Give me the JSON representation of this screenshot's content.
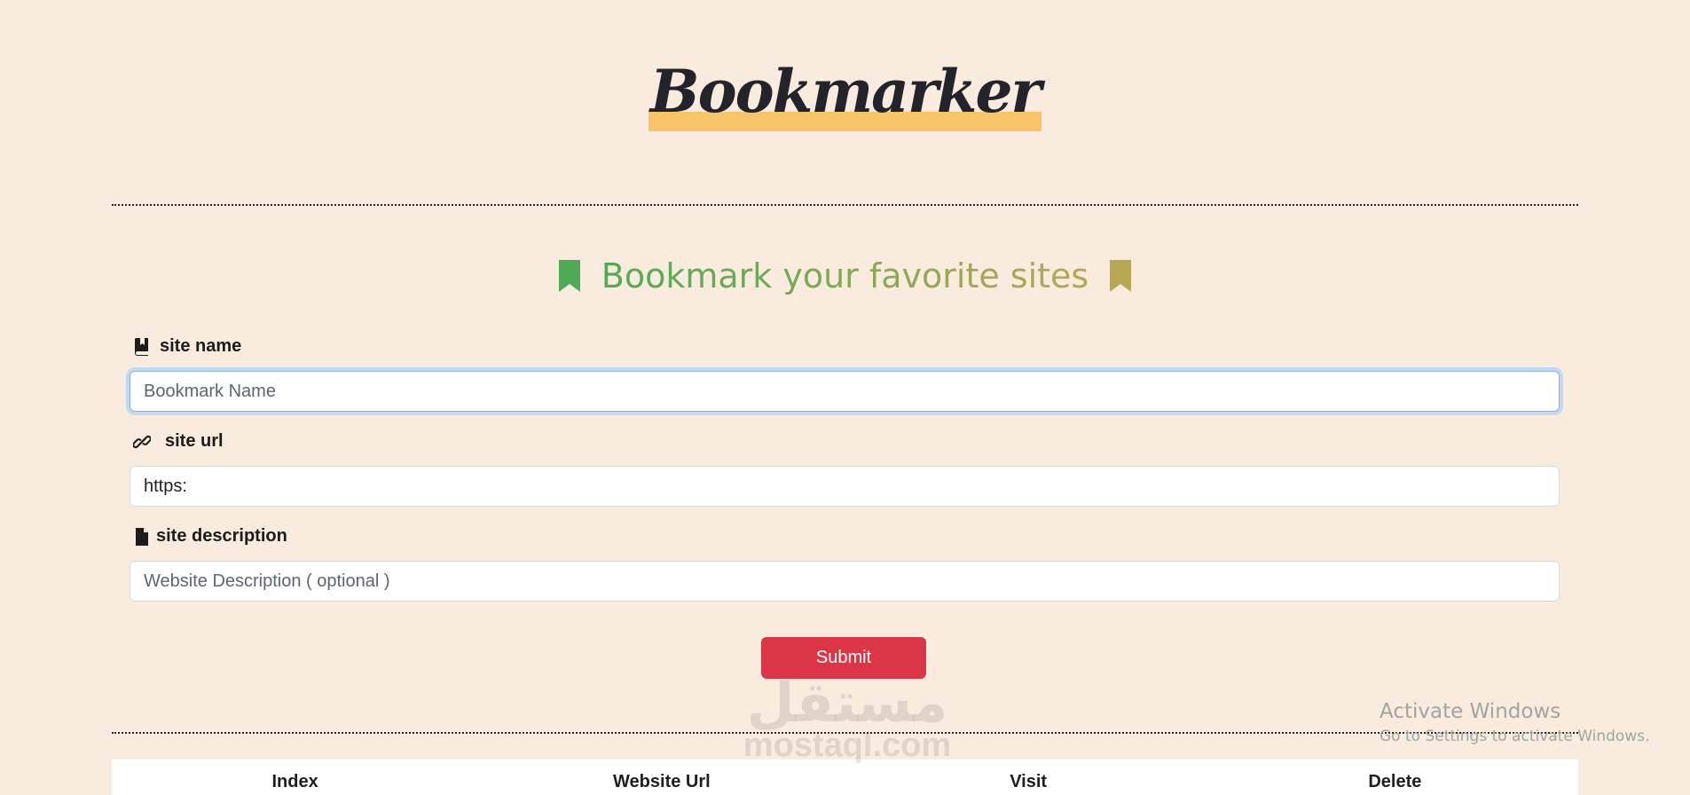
{
  "header": {
    "logo_text": "Bookmarker"
  },
  "form": {
    "heading": "Bookmark your favorite sites",
    "site_name": {
      "label": "site name",
      "placeholder": "Bookmark Name",
      "icon": "book-bookmark-icon"
    },
    "site_url": {
      "label": "site url",
      "value": "https:",
      "icon": "link-icon"
    },
    "site_description": {
      "label": "site description",
      "placeholder": "Website Description ( optional )",
      "icon": "file-icon"
    },
    "submit_label": "Submit"
  },
  "table": {
    "headers": [
      "Index",
      "Website Url",
      "Visit",
      "Delete"
    ]
  },
  "watermark": {
    "arabic": "مستقل",
    "latin": "mostaql.com"
  },
  "os_overlay": {
    "title": "Activate Windows",
    "subtitle": "Go to Settings to activate Windows."
  },
  "colors": {
    "background": "#f9ebdd",
    "logo_highlight": "#f8c46a",
    "heading_start": "#4faa58",
    "heading_end": "#b6a853",
    "submit": "#dc3545",
    "focus_ring": "#c4d8f3"
  }
}
